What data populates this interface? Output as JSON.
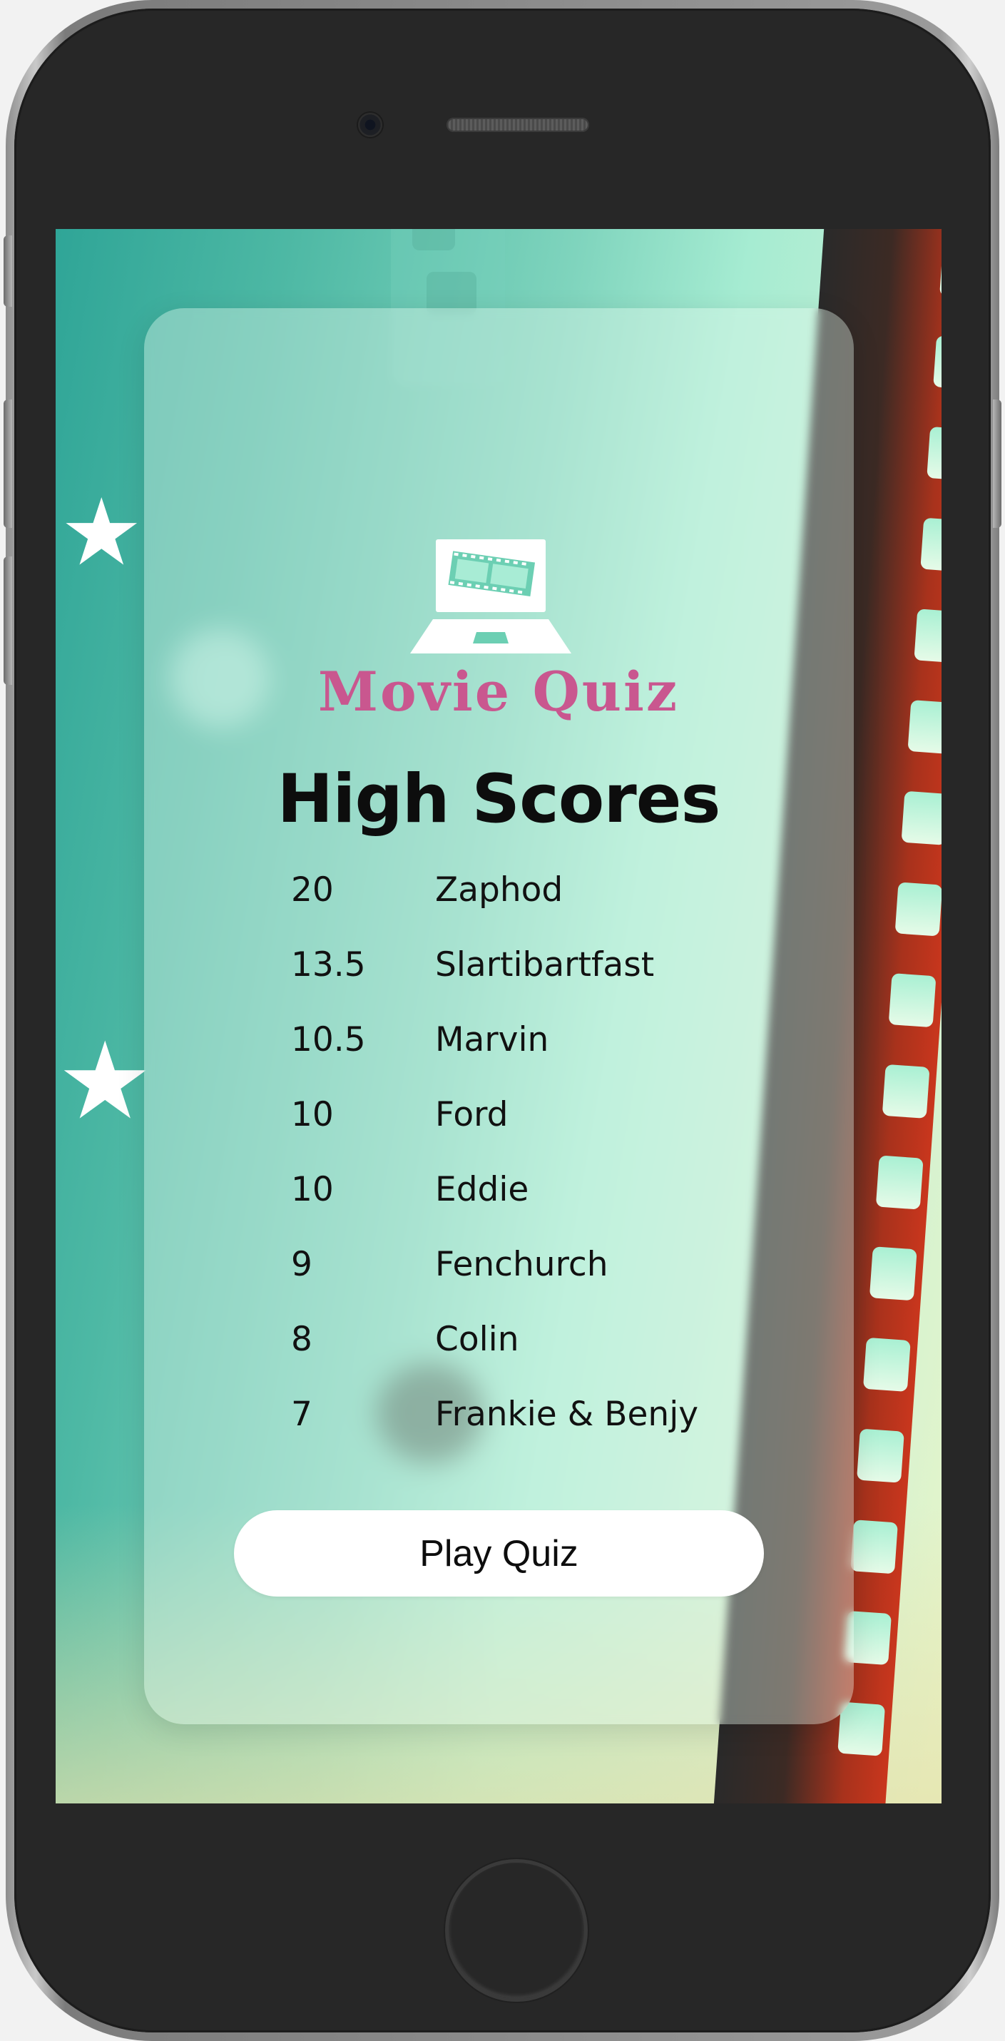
{
  "app": {
    "logo_text": "Movie Quiz"
  },
  "page": {
    "title": "High Scores"
  },
  "high_scores": [
    {
      "score": "20",
      "name": "Zaphod"
    },
    {
      "score": "13.5",
      "name": "Slartibartfast"
    },
    {
      "score": "10.5",
      "name": "Marvin"
    },
    {
      "score": "10",
      "name": "Ford"
    },
    {
      "score": "10",
      "name": "Eddie"
    },
    {
      "score": "9",
      "name": "Fenchurch"
    },
    {
      "score": "8",
      "name": "Colin"
    },
    {
      "score": "7",
      "name": "Frankie & Benjy"
    }
  ],
  "actions": {
    "play_label": "Play Quiz"
  },
  "colors": {
    "logo_pink": "#c9578f",
    "logo_white": "#ffffff",
    "background_teal": "#2fa597",
    "background_mint": "#a6ecd2",
    "film_red": "#c9361d",
    "button_bg": "#ffffff",
    "text_dark": "#0d0d0d"
  },
  "icons": {
    "logo": "laptop-filmstrip-icon",
    "decor_star": "star-icon"
  }
}
